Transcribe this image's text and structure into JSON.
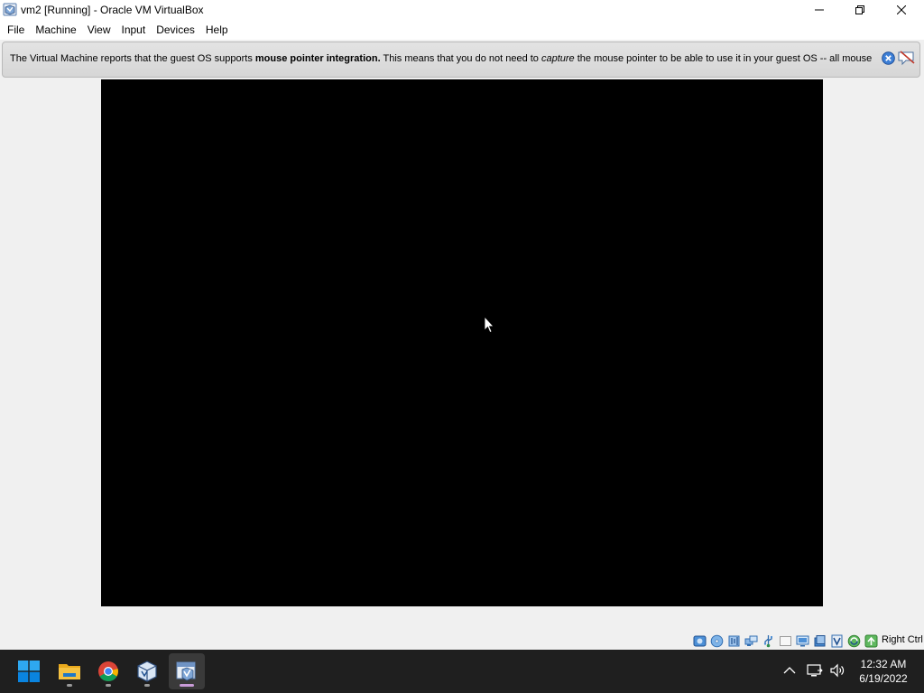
{
  "window": {
    "title": "vm2 [Running] - Oracle VM VirtualBox"
  },
  "menu": {
    "items": [
      "File",
      "Machine",
      "View",
      "Input",
      "Devices",
      "Help"
    ]
  },
  "banner": {
    "text_1": "The Virtual Machine reports that the guest OS supports ",
    "bold": "mouse pointer integration.",
    "text_2": " This means that you do not need to ",
    "italic": "capture",
    "text_3": " the mouse pointer to be able to use it in your guest OS -- all mouse"
  },
  "statusbar": {
    "icons": [
      "hard-disk-icon",
      "optical-drive-icon",
      "audio-icon",
      "network-icon",
      "usb-icon",
      "shared-folders-icon",
      "display-icon",
      "recording-icon",
      "virtualization-icon",
      "guest-additions-icon",
      "mouse-integration-icon"
    ],
    "host_key": "Right Ctrl"
  },
  "taskbar": {
    "apps": [
      "start-icon",
      "file-explorer-icon",
      "chrome-icon",
      "virtualbox-manager-icon",
      "virtualbox-vm-icon"
    ],
    "time": "12:32 AM",
    "date": "6/19/2022"
  },
  "colors": {
    "taskbar_bg": "#1f1f1f",
    "vm_screen": "#000000",
    "windows_blue": "#0a84e0",
    "explorer_yellow": "#f5c242"
  }
}
